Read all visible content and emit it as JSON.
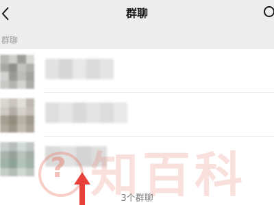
{
  "header": {
    "title": "群聊",
    "back_icon": "chevron-left-icon",
    "search_icon": "search-icon"
  },
  "section": {
    "label": "群聊"
  },
  "groups": [
    {
      "name": "",
      "avatar": "blurred-group-avatar"
    },
    {
      "name": "",
      "avatar": "blurred-group-avatar"
    },
    {
      "name": "",
      "avatar": "blurred-group-avatar"
    }
  ],
  "footer": {
    "count_label": "3个群聊"
  },
  "watermark": {
    "text": "知百科",
    "symbol": "?"
  },
  "annotation": {
    "arrow_color": "#e8413a"
  },
  "colors": {
    "background": "#ededed",
    "list_background": "#ffffff",
    "watermark": "#e87460"
  }
}
